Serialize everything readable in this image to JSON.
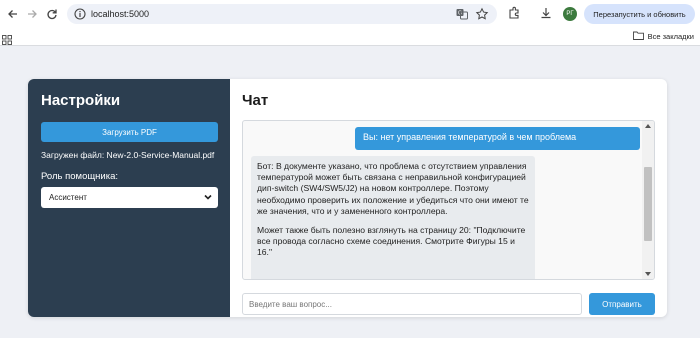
{
  "browser": {
    "url": "localhost:5000",
    "relaunch_label": "Перезапустить и обновить",
    "avatar_initials": "РГ",
    "all_bookmarks_label": "Все закладки"
  },
  "sidebar": {
    "title": "Настройки",
    "upload_button": "Загрузить PDF",
    "uploaded_file": "Загружен файл: New-2.0-Service-Manual.pdf",
    "role_label": "Роль помощника:",
    "role_selected": "Ассистент"
  },
  "main": {
    "title": "Чат",
    "messages": {
      "user": "Вы: нет управления температурой в чем проблема",
      "bot_p1": "Бот: В документе указано, что проблема с отсутствием управления температурой может быть связана с неправильной конфигурацией дип-switch (SW4/SW5/J2) на новом контроллере. Поэтому необходимо проверить их положение и убедиться что они имеют те же значения, что и у замененного контроллера.",
      "bot_p2": "Может также быть полезно взглянуть на страницу 20: \"Подключите все провода согласно схеме соединения. Смотрите Фигуры 15 и 16.\""
    },
    "input_placeholder": "Введите ваш вопрос...",
    "send_button": "Отправить"
  },
  "colors": {
    "sidebar_bg": "#2c3e50",
    "accent": "#3498db"
  }
}
